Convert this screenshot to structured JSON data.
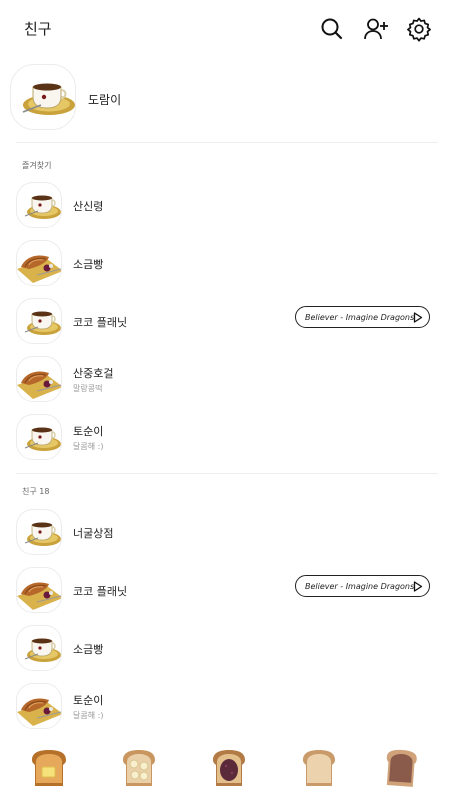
{
  "header": {
    "title": "친구"
  },
  "my_profile": {
    "name": "도람이"
  },
  "favorites": {
    "label": "즐겨찾기",
    "items": [
      {
        "name": "산신령",
        "status": "",
        "music": "",
        "avatar": "coffee-icon"
      },
      {
        "name": "소금빵",
        "status": "",
        "music": "",
        "avatar": "croissant-icon"
      },
      {
        "name": "코코 플래닛",
        "status": "",
        "music": "Believer - Imagine Dragons",
        "avatar": "coffee-icon"
      },
      {
        "name": "산중호걸",
        "status": "말랑콩떡",
        "music": "",
        "avatar": "croissant-icon"
      },
      {
        "name": "토순이",
        "status": "달콤해 :)",
        "music": "",
        "avatar": "coffee-icon"
      }
    ]
  },
  "friends": {
    "label": "친구 18",
    "items": [
      {
        "name": "너굴상점",
        "status": "",
        "music": "",
        "avatar": "coffee-icon"
      },
      {
        "name": "코코 플래닛",
        "status": "",
        "music": "Believer - Imagine Dragons",
        "avatar": "croissant-icon"
      },
      {
        "name": "소금빵",
        "status": "",
        "music": "",
        "avatar": "coffee-icon"
      },
      {
        "name": "토순이",
        "status": "달콤해 :)",
        "music": "",
        "avatar": "croissant-icon"
      }
    ]
  },
  "bottom_tabs": [
    "butter-toast-icon",
    "banana-toast-icon",
    "chocolate-toast-icon",
    "plain-toast-icon",
    "nutella-toast-icon"
  ]
}
